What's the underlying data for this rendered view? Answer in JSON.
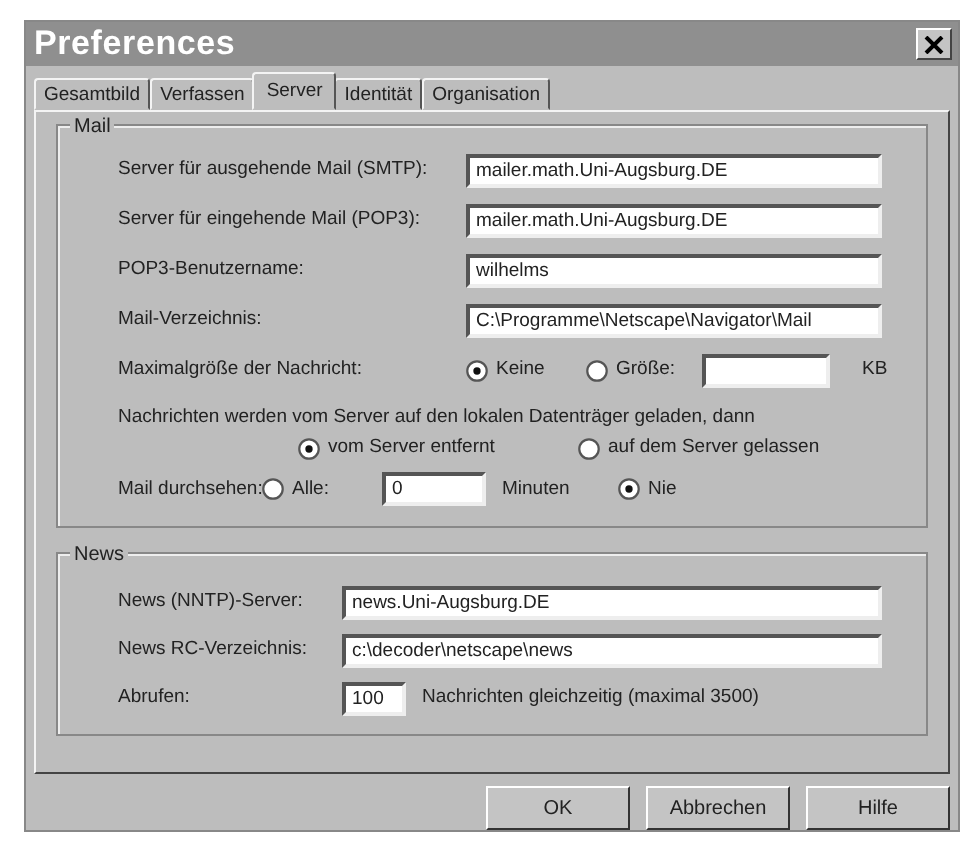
{
  "window": {
    "title": "Preferences"
  },
  "tabs": [
    {
      "label": "Gesamtbild",
      "selected": false
    },
    {
      "label": "Verfassen",
      "selected": false
    },
    {
      "label": "Server",
      "selected": true
    },
    {
      "label": "Identität",
      "selected": false
    },
    {
      "label": "Organisation",
      "selected": false
    }
  ],
  "mail": {
    "title": "Mail",
    "fields": [
      {
        "label": "Server für ausgehende Mail (SMTP):",
        "value": "mailer.math.Uni-Augsburg.DE"
      },
      {
        "label": "Server für eingehende Mail (POP3):",
        "value": "mailer.math.Uni-Augsburg.DE"
      },
      {
        "label": "POP3-Benutzername:",
        "value": "wilhelms"
      },
      {
        "label": "Mail-Verzeichnis:",
        "value": "C:\\Programme\\Netscape\\Navigator\\Mail"
      }
    ],
    "max_size": {
      "label": "Maximalgröße der Nachricht:",
      "options": [
        {
          "label": "Keine",
          "selected": true
        },
        {
          "label": "Größe:",
          "selected": false
        }
      ],
      "unit": "KB"
    },
    "download": {
      "text": "Nachrichten werden vom Server auf den lokalen Datenträger geladen, dann",
      "options": [
        {
          "label": "vom Server entfernt",
          "selected": true
        },
        {
          "label": "auf dem Server gelassen",
          "selected": false
        }
      ]
    },
    "check": {
      "label": "Mail durchsehen:",
      "items": [
        {
          "kind": "radio",
          "label": "Alle:",
          "selected": false
        },
        {
          "kind": "field",
          "value": "0"
        },
        {
          "kind": "text",
          "label": "Minuten"
        },
        {
          "kind": "radio",
          "label": "Nie",
          "selected": true
        }
      ]
    }
  },
  "news": {
    "title": "News",
    "fields": [
      {
        "label": "News (NNTP)-Server:",
        "value": "news.Uni-Augsburg.DE"
      },
      {
        "label": "News RC-Verzeichnis:",
        "value": "c:\\decoder\\netscape\\news"
      }
    ],
    "fetch": {
      "label": "Abrufen:",
      "value": "100",
      "note": "Nachrichten gleichzeitig (maximal 3500)"
    }
  },
  "buttons": [
    "OK",
    "Abbrechen",
    "Hilfe"
  ]
}
